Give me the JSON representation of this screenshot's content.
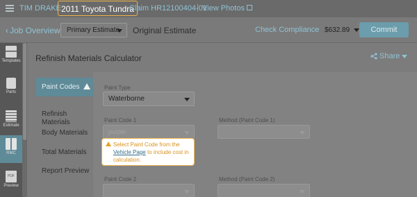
{
  "topbar": {
    "user": "TIM DRAKE",
    "vehicle": "2011 Toyota Tundra",
    "claim": "Claim HR12100404-01",
    "separator": "|",
    "view_photos": "View Photos"
  },
  "subbar": {
    "back_label": "Job Overview",
    "estimate_select": "Primary Estimate",
    "original_estimate": "Original Estimate",
    "check_compliance": "Check Compliance",
    "total": "$632.89",
    "commit": "Commit"
  },
  "tools": [
    {
      "label": "Templates",
      "icon": "templates-icon"
    },
    {
      "label": "Parts",
      "icon": "parts-icon"
    },
    {
      "label": "Estimate",
      "icon": "estimate-icon"
    },
    {
      "label": "RMC",
      "icon": "rmc-calculator-icon"
    },
    {
      "label": "Preview",
      "icon": "pdf-preview-icon",
      "badge": "PDF"
    }
  ],
  "page": {
    "title": "Refinish Materials Calculator",
    "share": "Share"
  },
  "sidenav": [
    {
      "label": "Paint Codes"
    },
    {
      "label": "Refinish\nMaterials"
    },
    {
      "label": "Body Materials"
    },
    {
      "label": "Total Materials"
    },
    {
      "label": "Report Preview"
    }
  ],
  "form": {
    "paint_type_label": "Paint Type",
    "paint_type_value": "Waterborne",
    "paint_code_1_label": "Paint Code 1",
    "paint_code_1_value": "purple",
    "method_1_label": "Method (Paint Code 1)",
    "paint_code_2_label": "Paint Code 2",
    "method_2_label": "Method (Paint Code 2)"
  },
  "warning": {
    "prefix": "Select Paint Code from the",
    "link": "Vehicle Page",
    "suffix": "to include cost in calculation."
  },
  "colors": {
    "accent": "#8fc3d6",
    "active_nav": "#5f8a98",
    "warning": "#f0b44c",
    "link": "#2f6a86"
  }
}
